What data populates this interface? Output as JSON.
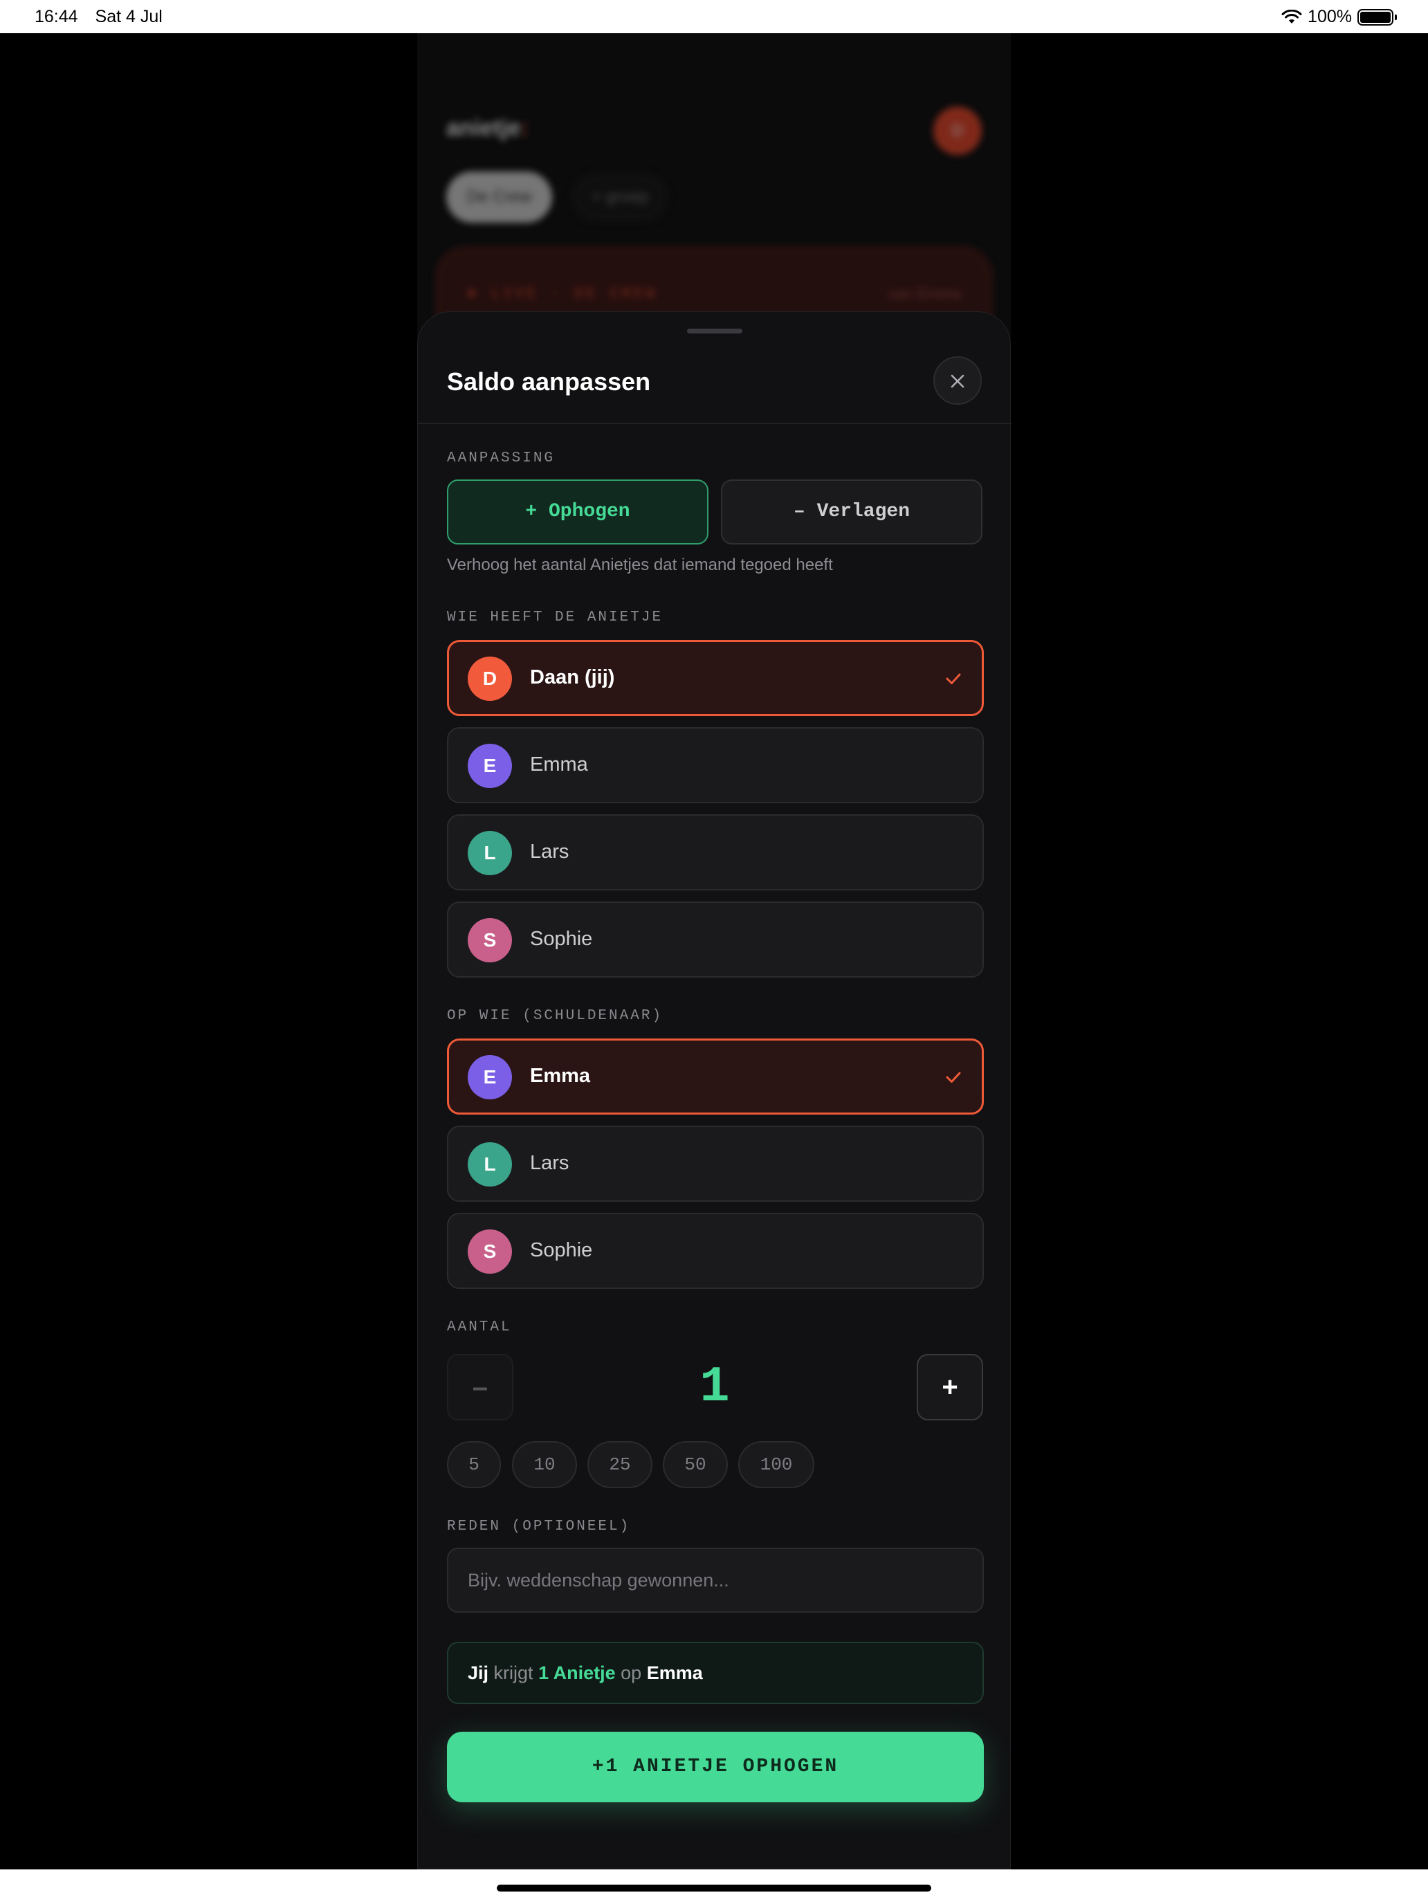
{
  "status_bar": {
    "time": "16:44",
    "date": "Sat 4 Jul",
    "battery": "100%"
  },
  "background": {
    "logo": "anietje",
    "logo_accent": ":",
    "avatar": "D",
    "chips": [
      "De Crew",
      "+ groep"
    ],
    "live_label": "● LIVE · DE CREW",
    "live_from": "van Emma"
  },
  "sheet": {
    "title": "Saldo aanpassen",
    "close_icon": "close-icon",
    "adjustment": {
      "label": "AANPASSING",
      "increase": "+ Ophogen",
      "decrease": "– Verlagen",
      "help": "Verhoog het aantal Anietjes dat iemand tegoed heeft"
    },
    "who_has": {
      "label": "WIE HEEFT DE ANIETJE",
      "people": [
        {
          "initial": "D",
          "name": "Daan (jij)",
          "color": "#f25a3c",
          "selected": true
        },
        {
          "initial": "E",
          "name": "Emma",
          "color": "#7b5fe6",
          "selected": false
        },
        {
          "initial": "L",
          "name": "Lars",
          "color": "#3aa58a",
          "selected": false
        },
        {
          "initial": "S",
          "name": "Sophie",
          "color": "#c9608b",
          "selected": false
        }
      ]
    },
    "on_whom": {
      "label": "OP WIE (SCHULDENAAR)",
      "people": [
        {
          "initial": "E",
          "name": "Emma",
          "color": "#7b5fe6",
          "selected": true
        },
        {
          "initial": "L",
          "name": "Lars",
          "color": "#3aa58a",
          "selected": false
        },
        {
          "initial": "S",
          "name": "Sophie",
          "color": "#c9608b",
          "selected": false
        }
      ]
    },
    "amount": {
      "label": "AANTAL",
      "value": "1",
      "minus": "–",
      "plus": "+",
      "quick": [
        "5",
        "10",
        "25",
        "50",
        "100"
      ]
    },
    "reason": {
      "label": "REDEN (OPTIONEEL)",
      "placeholder": "Bijv. weddenschap gewonnen...",
      "value": ""
    },
    "summary": {
      "subject": "Jij",
      "verb": "krijgt",
      "amount": "1 Anietje",
      "prep": "op",
      "target": "Emma"
    },
    "submit": "+1 ANIETJE OPHOGEN"
  },
  "colors": {
    "accent_green": "#45db96",
    "accent_red": "#ee5a38",
    "sheet_bg": "#111113"
  }
}
